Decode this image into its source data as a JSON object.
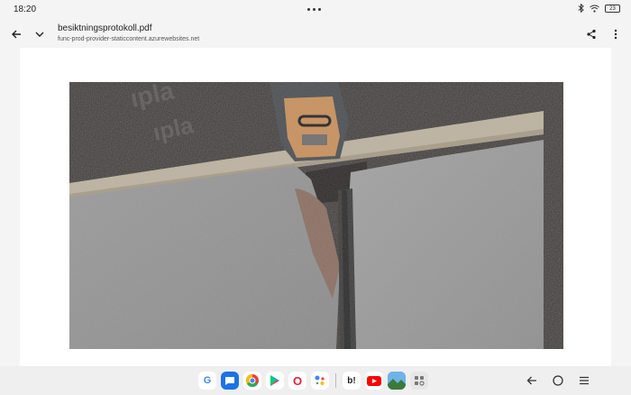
{
  "status_bar": {
    "time": "18:20",
    "battery": "23",
    "icons": [
      "bluetooth-icon",
      "wifi-icon",
      "battery-icon"
    ]
  },
  "toolbar": {
    "title": "besiktningsprotokoll.pdf",
    "url": "func-prod-provider-staticcontent.azurewebsites.net",
    "icons": [
      "back-arrow-icon",
      "chevron-down-icon",
      "share-icon",
      "more-vert-icon"
    ]
  },
  "document": {
    "photo_label": "concrete-joint-photo"
  },
  "dock": {
    "apps": [
      {
        "name": "google-app",
        "glyph": "G",
        "color": "#4285F4"
      },
      {
        "name": "messages-app",
        "glyph": "💬",
        "color": "#1a73e8"
      },
      {
        "name": "chrome-app",
        "glyph": "",
        "color": "#34A853"
      },
      {
        "name": "play-store-app",
        "glyph": "▶",
        "color": "#00A0FF"
      },
      {
        "name": "opera-app",
        "glyph": "O",
        "color": "#e8203b"
      },
      {
        "name": "assistant-app",
        "glyph": "",
        "color": "#4285F4"
      },
      {
        "name": "bokus-app",
        "glyph": "b!",
        "color": "#222222"
      },
      {
        "name": "youtube-app",
        "glyph": "▶",
        "color": "#ff0000"
      },
      {
        "name": "photo-app",
        "glyph": "",
        "color": "#2a7bd1"
      },
      {
        "name": "app-drawer",
        "glyph": "",
        "color": "#888888"
      }
    ]
  },
  "nav_keys": [
    "back-nav-icon",
    "home-nav-icon",
    "recents-nav-icon"
  ]
}
